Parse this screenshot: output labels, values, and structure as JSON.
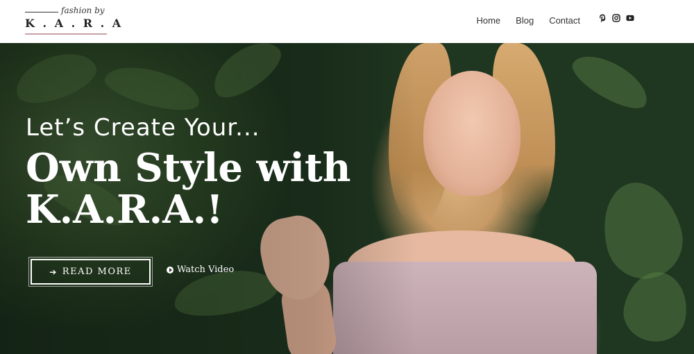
{
  "logo": {
    "script_text": "fashion by",
    "mark_text": "K . A . R . A"
  },
  "nav": {
    "items": [
      "Home",
      "Blog",
      "Contact"
    ]
  },
  "social": {
    "icons": [
      "pinterest-icon",
      "instagram-icon",
      "youtube-icon"
    ]
  },
  "hero": {
    "kicker": "Let’s Create Your...",
    "headline": "Own Style with K.A.R.A.!",
    "read_more_label": "READ MORE",
    "watch_video_label": "Watch Video"
  },
  "colors": {
    "header_bg": "#ffffff",
    "accent_line": "#c9a3a8",
    "hero_text": "#ffffff"
  }
}
